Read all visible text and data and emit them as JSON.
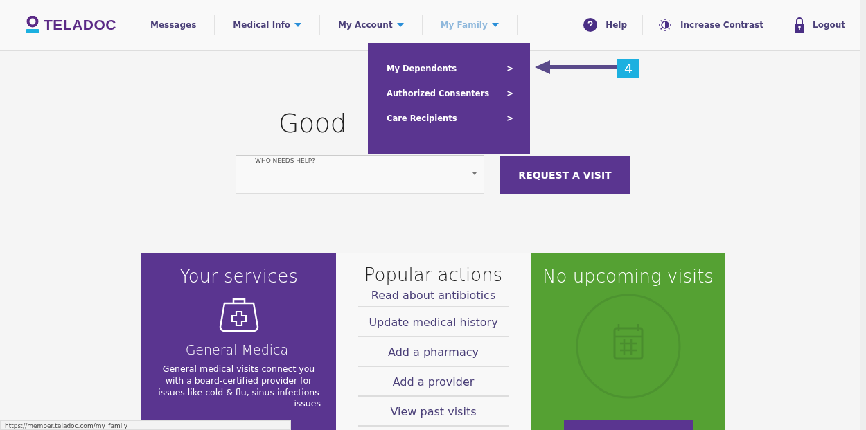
{
  "header": {
    "logo": "TELADOC",
    "nav": [
      {
        "label": "Messages",
        "dropdown": false,
        "selected": false
      },
      {
        "label": "Medical Info",
        "dropdown": true,
        "selected": false
      },
      {
        "label": "My Account",
        "dropdown": true,
        "selected": false
      },
      {
        "label": "My Family",
        "dropdown": true,
        "selected": true
      }
    ],
    "utilities": [
      {
        "kind": "help",
        "label": "Help"
      },
      {
        "kind": "contrast",
        "label": "Increase Contrast"
      },
      {
        "kind": "logout",
        "label": "Logout"
      }
    ]
  },
  "menu": {
    "items": [
      {
        "label": "My Dependents",
        "arrow": ">"
      },
      {
        "label": "Authorized Consenters",
        "arrow": ">"
      },
      {
        "label": "Care Recipients",
        "arrow": ">"
      }
    ]
  },
  "annotation": {
    "step": "4"
  },
  "greeting": "Good",
  "who_needs_help": {
    "label": "WHO NEEDS HELP?"
  },
  "request_button": "REQUEST A VISIT",
  "services": {
    "title": "Your services",
    "service": "General Medical",
    "description": "General medical visits connect you with a board-certified provider for issues like cold & flu, sinus infections",
    "description_cut": "issues"
  },
  "popular": {
    "title": "Popular actions",
    "actions": [
      "Read about antibiotics",
      "Update medical history",
      "Add a pharmacy",
      "Add a provider",
      "View past visits"
    ]
  },
  "visits": {
    "title": "No upcoming visits"
  },
  "status_bar": "https://member.teladoc.com/my_family"
}
